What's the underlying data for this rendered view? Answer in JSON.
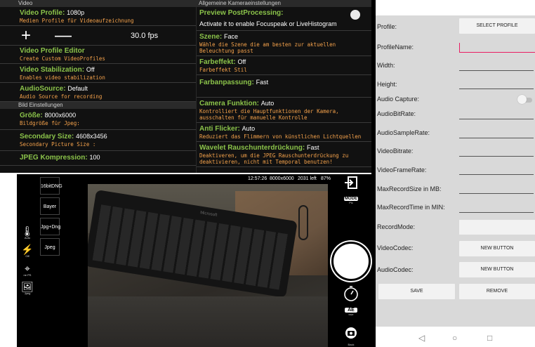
{
  "settings_left": {
    "section1": "Video",
    "video_profile": {
      "name": "Video Profile:",
      "value": "1080p",
      "desc": "Medien Profile für Videoaufzeichnung"
    },
    "fps": {
      "plus": "+",
      "minus": "—",
      "value": "30.0 fps"
    },
    "profile_editor": {
      "name": "Video Profile Editor",
      "desc": "Create Custom VideoProfiles"
    },
    "stabilization": {
      "name": "Video Stabilization:",
      "value": "Off",
      "desc": "Enables video stabilization"
    },
    "audio_source": {
      "name": "AudioSource:",
      "value": "Default",
      "desc": "Audio Source for recording"
    },
    "section2": "Bild Einstellungen",
    "size": {
      "name": "Größe:",
      "value": "8000x6000",
      "desc": "Bildgröße für Jpeg:"
    },
    "secondary_size": {
      "name": "Secondary Size:",
      "value": "4608x3456",
      "desc": "Secondary Picture Size :"
    },
    "jpeg_compression": {
      "name": "JPEG Kompression:",
      "value": "100"
    }
  },
  "settings_right": {
    "section": "Allgemeine Kameraeinstellungen",
    "preview_pp": {
      "name": "Preview PostProcessing:",
      "desc": "Activate it to enable Focuspeak or LiveHistogram"
    },
    "scene": {
      "name": "Szene:",
      "value": "Face",
      "desc1": "Wähle die Szene die am besten zur aktuellen",
      "desc2": "Beleuchtung passt"
    },
    "color_effect": {
      "name": "Farbeffekt:",
      "value": "Off",
      "desc": "Farbeffekt Stil"
    },
    "color_adjust": {
      "name": "Farbanpassung:",
      "value": "Fast"
    },
    "camera_func": {
      "name": "Camera Funktion:",
      "value": "Auto",
      "desc1": "Kontrolliert die Hauptfunktionen der Kamera,",
      "desc2": "ausschalten für manuelle Kontrolle"
    },
    "anti_flicker": {
      "name": "Anti Flicker:",
      "value": "Auto",
      "desc": "Reduziert das Flimmern von künstlichen Lichtquellen"
    },
    "wavelet": {
      "name": "Wavelet Rauschunterdrückung:",
      "value": "Fast",
      "desc1": "Deaktiveren, um die JPEG Rauschunterdrückung zu",
      "desc2": "deaktivieren, nicht mit Temporal benutzen!"
    }
  },
  "profile_editor_form": {
    "profile_label": "Profile:",
    "select_profile": "SELECT PROFILE",
    "profile_name": "ProfileName:",
    "width": "Width:",
    "height": "Height:",
    "audio_capture": "Audio Capture:",
    "audio_bitrate": "AudioBitRate:",
    "audio_samplerate": "AudioSampleRate:",
    "video_bitrate": "VideoBitrate:",
    "video_framerate": "VideoFrameRate:",
    "max_record_size": "MaxRecordSize in MB:",
    "max_record_time": "MaxRecordTime in MIN:",
    "record_mode": "RecordMode:",
    "video_codec": "VideoCodec:",
    "new_button_1": "NEW BUTTON",
    "audio_codec": "AudioCodec:",
    "new_button_2": "NEW BUTTON",
    "save": "SAVE",
    "remove": "REMOVE"
  },
  "nav": {
    "back": "◁",
    "home": "○",
    "recents": "□"
  },
  "camera": {
    "time": "12:57:26",
    "resolution": "8000x6000",
    "count": "2031 left",
    "battery": "87%",
    "formats": [
      "16bitDNG",
      "Bayer",
      "Jpg+Dng",
      "Jpeg"
    ],
    "left_icons": [
      {
        "glyph": "🌡",
        "sub": "Auto"
      },
      {
        "glyph": "⚡",
        "sub": "Off"
      },
      {
        "glyph": "⌖",
        "sub": "ne PS"
      },
      {
        "glyph": "🖼",
        "sub": "Jpeg"
      }
    ],
    "mode_label": "MODE",
    "mode_sub": "Pic",
    "ae_label": "AE",
    "ae_sub": "true",
    "back_sub": "Back",
    "vf_logo": "Microsoft"
  }
}
